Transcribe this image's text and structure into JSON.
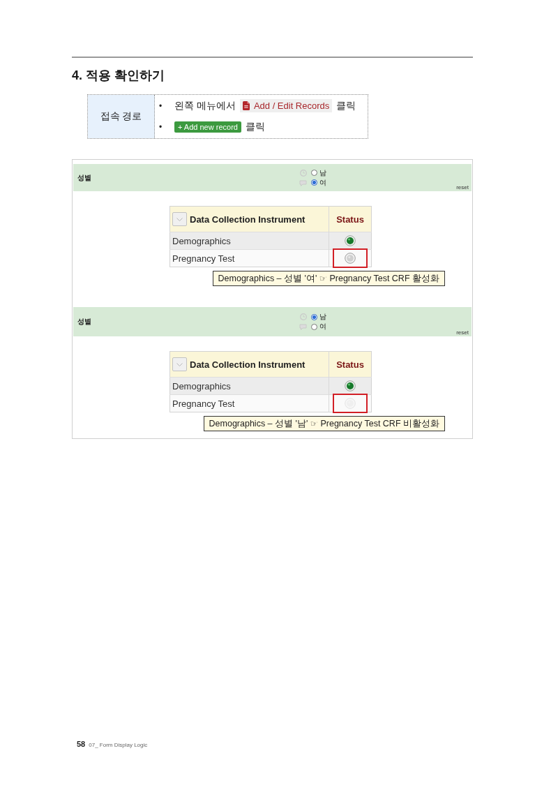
{
  "section_title": "4. 적용 확인하기",
  "access_path": {
    "label": "접속 경로",
    "steps": [
      {
        "kind": "menu-link",
        "marker": "•",
        "prefix": "왼쪽 메뉴에서",
        "control": "Add / Edit Records",
        "suffix": "클릭"
      },
      {
        "kind": "button",
        "marker": "•",
        "control": "+ Add new record",
        "suffix": "클릭"
      }
    ]
  },
  "examples": [
    {
      "field": {
        "label": "성별",
        "options": [
          {
            "label": "남",
            "selected": false
          },
          {
            "label": "여",
            "selected": true
          }
        ],
        "reset": "reset"
      },
      "table": {
        "columns": [
          "Data Collection Instrument",
          "Status"
        ],
        "rows": [
          {
            "name": "Demographics",
            "kind": "complete",
            "disabled": false,
            "highlighted": false
          },
          {
            "name": "Pregnancy Test",
            "kind": "incomplete",
            "disabled": false,
            "highlighted": true
          }
        ]
      },
      "callout": "Demographics – 성별 '여' ☞ Pregnancy Test CRF 활성화"
    },
    {
      "field": {
        "label": "성별",
        "options": [
          {
            "label": "남",
            "selected": true
          },
          {
            "label": "여",
            "selected": false
          }
        ],
        "reset": "reset"
      },
      "table": {
        "columns": [
          "Data Collection Instrument",
          "Status"
        ],
        "rows": [
          {
            "name": "Demographics",
            "kind": "complete",
            "disabled": false,
            "highlighted": false
          },
          {
            "name": "Pregnancy Test",
            "kind": "incomplete",
            "disabled": true,
            "highlighted": true
          }
        ]
      },
      "callout": "Demographics – 성별 '남' ☞ Pregnancy Test CRF 비활성화"
    }
  ],
  "footer": {
    "page": "58",
    "chapter": "07_ Form Display Logic"
  }
}
